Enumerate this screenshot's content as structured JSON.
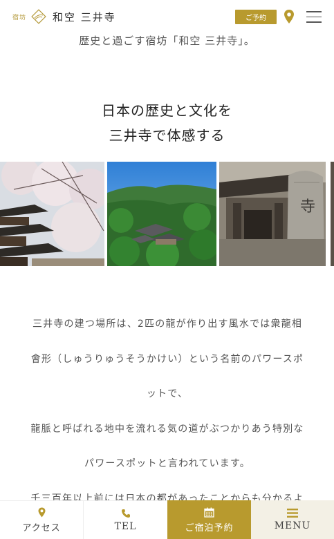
{
  "header": {
    "logo_small": "宿坊",
    "logo_name": "和空 三井寺",
    "reserve_label": "ご予約",
    "icons": [
      "map-pin-icon",
      "hamburger-menu-icon"
    ]
  },
  "main": {
    "lead_text": "歴史と過ごす宿坊「和空 三井寺」。",
    "heading_lines": [
      "日本の歴史と文化を",
      "三井寺で体感する"
    ],
    "gallery": [
      "pagoda-cherry-blossom-photo",
      "temple-in-green-mountains-photo",
      "temple-gate-stone-monument-photo"
    ],
    "paragraph_lines": [
      "三井寺の建つ場所は、2匹の龍が作り出す風水では衆龍相",
      "會形（しゅうりゅうそうかけい）という名前のパワースポ",
      "ットで、",
      "龍脈と呼ばれる地中を流れる気の道がぶつかりあう特別な",
      "パワースポットと言われています。",
      "千三百年以上前には日本の都があったことからも分かるよ"
    ]
  },
  "bottom_nav": {
    "access": "アクセス",
    "tel": "TEL",
    "booking": "ご宿泊予約",
    "menu": "MENU"
  },
  "colors": {
    "accent_gold": "#b89a2e",
    "menu_bg": "#f3f0e5"
  }
}
